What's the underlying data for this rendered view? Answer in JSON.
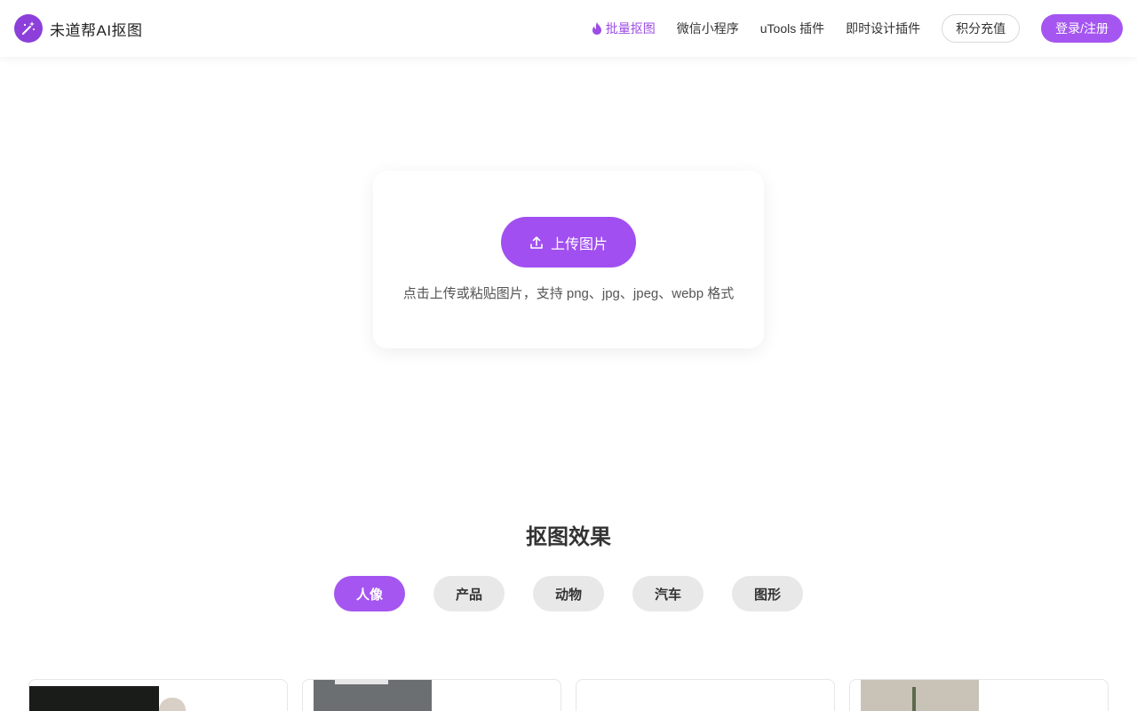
{
  "header": {
    "logo_text": "未道帮AI抠图",
    "logo_icon": "magic-wand-icon",
    "nav": {
      "batch": "批量抠图",
      "wechat": "微信小程序",
      "utools": "uTools 插件",
      "instant_design": "即时设计插件",
      "recharge": "积分充值",
      "login": "登录/注册"
    }
  },
  "upload": {
    "button_label": "上传图片",
    "hint": "点击上传或粘贴图片，支持 png、jpg、jpeg、webp 格式"
  },
  "examples": {
    "title": "抠图效果",
    "tabs": [
      "人像",
      "产品",
      "动物",
      "汽车",
      "图形"
    ],
    "active_tab": "人像"
  },
  "colors": {
    "accent": "#a556f0",
    "nav_active": "#9b4de6"
  }
}
